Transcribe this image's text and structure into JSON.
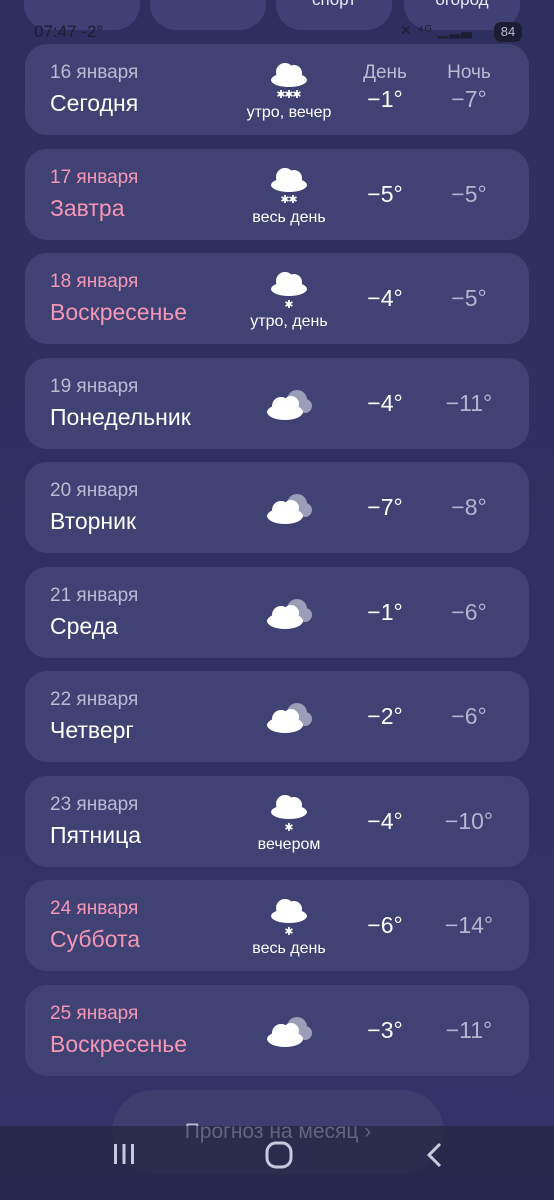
{
  "top_chips": [
    "",
    "",
    "спорт",
    "огород"
  ],
  "status_bar": {
    "time": "07:47",
    "temperature": "-2°",
    "battery": "84"
  },
  "forecast": {
    "header_day": "День",
    "header_night": "Ночь",
    "days": [
      {
        "date": "16 января",
        "name": "Сегодня",
        "precip": "утро, вечер",
        "day": "−1°",
        "night": "−7°",
        "icon": "snow-heavy-icon",
        "weekend": false
      },
      {
        "date": "17 января",
        "name": "Завтра",
        "precip": "весь день",
        "day": "−5°",
        "night": "−5°",
        "icon": "snow-moderate-icon",
        "weekend": true
      },
      {
        "date": "18 января",
        "name": "Воскресенье",
        "precip": "утро, день",
        "day": "−4°",
        "night": "−5°",
        "icon": "snow-light-icon",
        "weekend": true
      },
      {
        "date": "19 января",
        "name": "Понедельник",
        "precip": "",
        "day": "−4°",
        "night": "−11°",
        "icon": "cloudy-icon",
        "weekend": false
      },
      {
        "date": "20 января",
        "name": "Вторник",
        "precip": "",
        "day": "−7°",
        "night": "−8°",
        "icon": "cloudy-icon",
        "weekend": false
      },
      {
        "date": "21 января",
        "name": "Среда",
        "precip": "",
        "day": "−1°",
        "night": "−6°",
        "icon": "cloudy-icon",
        "weekend": false
      },
      {
        "date": "22 января",
        "name": "Четверг",
        "precip": "",
        "day": "−2°",
        "night": "−6°",
        "icon": "cloudy-icon",
        "weekend": false
      },
      {
        "date": "23 января",
        "name": "Пятница",
        "precip": "вечером",
        "day": "−4°",
        "night": "−10°",
        "icon": "snow-light-icon",
        "weekend": false
      },
      {
        "date": "24 января",
        "name": "Суббота",
        "precip": "весь день",
        "day": "−6°",
        "night": "−14°",
        "icon": "snow-light-icon",
        "weekend": true
      },
      {
        "date": "25 января",
        "name": "Воскресенье",
        "precip": "",
        "day": "−3°",
        "night": "−11°",
        "icon": "cloudy-icon",
        "weekend": true
      }
    ]
  },
  "month_button": {
    "label": "Прогноз на месяц ›"
  },
  "colors": {
    "background": "#2f3162",
    "card": "#404274",
    "weekend_text": "#f497b6",
    "secondary_text": "#b9bad4"
  }
}
